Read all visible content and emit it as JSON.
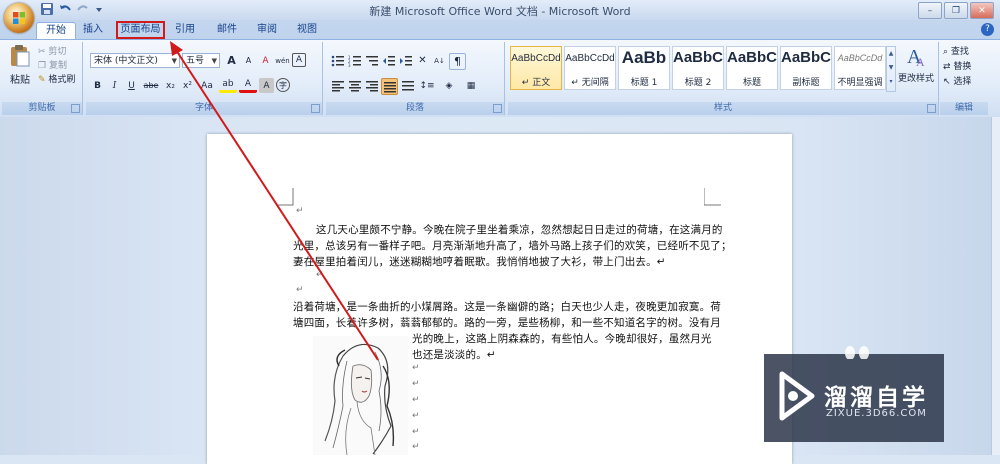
{
  "window": {
    "title": "新建 Microsoft Office Word 文档 - Microsoft Word",
    "buttons": [
      "–",
      "❐",
      "✕"
    ]
  },
  "tabs": [
    {
      "label": "开始",
      "active": true
    },
    {
      "label": "插入"
    },
    {
      "label": "页面布局",
      "highlighted": true
    },
    {
      "label": "引用"
    },
    {
      "label": "邮件"
    },
    {
      "label": "审阅"
    },
    {
      "label": "视图"
    }
  ],
  "ribbon": {
    "clipboard": {
      "label": "剪贴板",
      "paste": "粘贴",
      "cut": "剪切",
      "copy": "复制",
      "format_painter": "格式刷"
    },
    "font": {
      "label": "字体",
      "font_name": "宋体 (中文正文)",
      "font_size": "五号",
      "grow": "A",
      "shrink": "A",
      "clear": "A",
      "phonetic": "wén",
      "char_border": "A",
      "bold": "B",
      "italic": "I",
      "underline": "U",
      "strike": "abe",
      "subscript": "x₂",
      "superscript": "x²",
      "change_case": "Aa",
      "highlight": "ab",
      "font_color": "A",
      "char_shading": "A",
      "enclose": "字"
    },
    "paragraph": {
      "label": "段落"
    },
    "styles": {
      "label": "样式",
      "items": [
        {
          "sample": "AaBbCcDd",
          "name": "↵ 正文",
          "selected": true
        },
        {
          "sample": "AaBbCcDd",
          "name": "↵ 无间隔"
        },
        {
          "sample": "AaBb",
          "name": "标题 1"
        },
        {
          "sample": "AaBbC",
          "name": "标题 2"
        },
        {
          "sample": "AaBbC",
          "name": "标题"
        },
        {
          "sample": "AaBbC",
          "name": "副标题"
        },
        {
          "sample": "AaBbCcDd",
          "name": "不明显强调"
        }
      ],
      "change_styles": "更改样式"
    },
    "editing": {
      "label": "编辑",
      "find": "查找",
      "replace": "替换",
      "select": "选择"
    }
  },
  "document": {
    "lines": [
      "这几天心里颇不宁静。今晚在院子里坐着乘凉，忽然想起日日走过的荷塘，在这满月的",
      "光里，总该另有一番样子吧。月亮渐渐地升高了，墙外马路上孩子们的欢笑，已经听不见了；",
      "妻在屋里拍着闰儿，迷迷糊糊地哼着眠歌。我悄悄地披了大衫，带上门出去。↵",
      "沿着荷塘，是一条曲折的小煤屑路。这是一条幽僻的路；白天也少人走，夜晚更加寂寞。荷",
      "塘四面，长着许多树，蓊蓊郁郁的。路的一旁，是些杨柳，和一些不知道名字的树。没有月",
      "光的晚上，这路上阴森森的，有些怕人。今晚却很好，虽然月光",
      "也还是淡淡的。↵"
    ],
    "return_mark": "↵"
  },
  "watermark": {
    "title": "溜溜自学",
    "subtitle": "ZIXUE.3D66.COM"
  },
  "colors": {
    "annotation": "#d11a1a",
    "ribbon_label": "#3e6aaa",
    "tab_text": "#15428b"
  }
}
